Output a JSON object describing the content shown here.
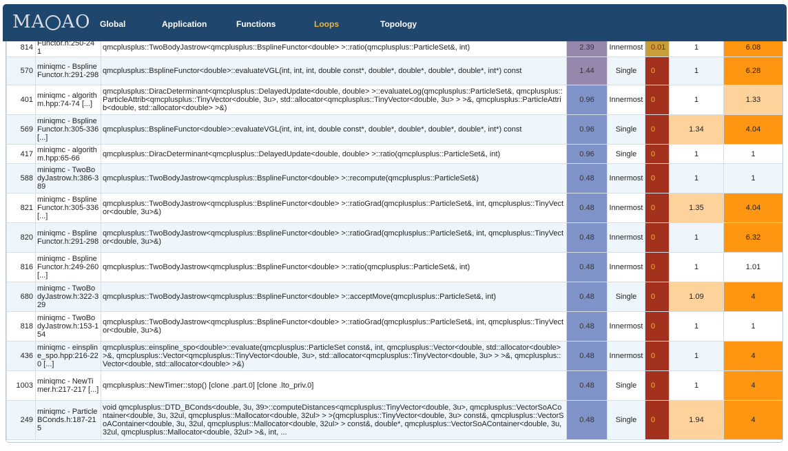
{
  "brand": {
    "logo_text_left": "MA",
    "logo_text_right": "AO"
  },
  "nav": [
    {
      "label": "Global",
      "active": false
    },
    {
      "label": "Application",
      "active": false
    },
    {
      "label": "Functions",
      "active": false
    },
    {
      "label": "Loops",
      "active": true
    },
    {
      "label": "Topology",
      "active": false
    }
  ],
  "colors": {
    "navbar": "#1f466d",
    "active_nav": "#f0b43a",
    "coverage": "#7f93c8",
    "coverage_hot": "#9687ad",
    "vector_ratio_zero": "#a4301e",
    "speedup_high": "#ff9612",
    "speedup_mid": "#fdd39b"
  },
  "rows": [
    {
      "id": "814",
      "source": "Functor.h:250-24 1",
      "function": "qmcplusplus::TwoBodyJastrow<qmcplusplus::BsplineFunctor<double> >::ratio(qmcplusplus::ParticleSet&, int)",
      "coverage": "2.39",
      "level": "Innermost",
      "vr": "0.01",
      "s1": "1",
      "s2": "6.08",
      "h": 16
    },
    {
      "id": "570",
      "source": "miniqmc - BsplineFunctor.h:291-298",
      "function": "qmcplusplus::BsplineFunctor<double>::evaluateVGL(int, int, int, double const*, double*, double*, double*, double*, int*) const",
      "coverage": "1.44",
      "level": "Single",
      "vr": "0",
      "s1": "1",
      "s2": "6.28",
      "h": 41
    },
    {
      "id": "401",
      "source": "miniqmc - algorithm.hpp:74-74 [...]",
      "function": "qmcplusplus::DiracDeterminant<qmcplusplus::DelayedUpdate<double, double> >::evaluateLog(qmcplusplus::ParticleSet&, qmcplusplus::ParticleAttrib<qmcplusplus::TinyVector<double, 3u>, std::allocator<qmcplusplus::TinyVector<double, 3u> > >&, qmcplusplus::ParticleAttrib<double, std::allocator<double> >&)",
      "coverage": "0.96",
      "level": "Innermost",
      "vr": "0",
      "s1": "1",
      "s2": "1.33",
      "h": 43
    },
    {
      "id": "569",
      "source": "miniqmc - BsplineFunctor.h:305-336 [...]",
      "function": "qmcplusplus::BsplineFunctor<double>::evaluateVGL(int, int, int, double const*, double*, double*, double*, double*, int*) const",
      "coverage": "0.96",
      "level": "Single",
      "vr": "0",
      "s1": "1.34",
      "s2": "4.04",
      "h": 43
    },
    {
      "id": "417",
      "source": "miniqmc - algorithm.hpp:65-66",
      "function": "qmcplusplus::DiracDeterminant<qmcplusplus::DelayedUpdate<double, double> >::ratio(qmcplusplus::ParticleSet&, int)",
      "coverage": "0.96",
      "level": "Single",
      "vr": "0",
      "s1": "1",
      "s2": "1",
      "h": 28
    },
    {
      "id": "588",
      "source": "miniqmc - TwoBodyJastrow.h:386-389",
      "function": "qmcplusplus::TwoBodyJastrow<qmcplusplus::BsplineFunctor<double> >::recompute(qmcplusplus::ParticleSet&)",
      "coverage": "0.48",
      "level": "Innermost",
      "vr": "0",
      "s1": "1",
      "s2": "1",
      "h": 43
    },
    {
      "id": "821",
      "source": "miniqmc - BsplineFunctor.h:305-336 [...]",
      "function": "qmcplusplus::TwoBodyJastrow<qmcplusplus::BsplineFunctor<double> >::ratioGrad(qmcplusplus::ParticleSet&, int, qmcplusplus::TinyVector<double, 3u>&)",
      "coverage": "0.48",
      "level": "Innermost",
      "vr": "0",
      "s1": "1.35",
      "s2": "4.04",
      "h": 43
    },
    {
      "id": "820",
      "source": "miniqmc - BsplineFunctor.h:291-298",
      "function": "qmcplusplus::TwoBodyJastrow<qmcplusplus::BsplineFunctor<double> >::ratioGrad(qmcplusplus::ParticleSet&, int, qmcplusplus::TinyVector<double, 3u>&)",
      "coverage": "0.48",
      "level": "Innermost",
      "vr": "0",
      "s1": "1",
      "s2": "6.32",
      "h": 43
    },
    {
      "id": "816",
      "source": "miniqmc - BsplineFunctor.h:249-260 [...]",
      "function": "qmcplusplus::TwoBodyJastrow<qmcplusplus::BsplineFunctor<double> >::ratio(qmcplusplus::ParticleSet&, int)",
      "coverage": "0.48",
      "level": "Innermost",
      "vr": "0",
      "s1": "1",
      "s2": "1.01",
      "h": 43
    },
    {
      "id": "680",
      "source": "miniqmc - TwoBodyJastrow.h:322-329",
      "function": "qmcplusplus::TwoBodyJastrow<qmcplusplus::BsplineFunctor<double> >::acceptMove(qmcplusplus::ParticleSet&, int)",
      "coverage": "0.48",
      "level": "Single",
      "vr": "0",
      "s1": "1.09",
      "s2": "4",
      "h": 43
    },
    {
      "id": "818",
      "source": "miniqmc - TwoBodyJastrow.h:153-154",
      "function": "qmcplusplus::TwoBodyJastrow<qmcplusplus::BsplineFunctor<double> >::ratioGrad(qmcplusplus::ParticleSet&, int, qmcplusplus::TinyVector<double, 3u>&)",
      "coverage": "0.48",
      "level": "Innermost",
      "vr": "0",
      "s1": "1",
      "s2": "1",
      "h": 43
    },
    {
      "id": "436",
      "source": "miniqmc - einspline_spo.hpp:216-220 [...]",
      "function": "qmcplusplus::einspline_spo<double>::evaluate(qmcplusplus::ParticleSet const&, int, qmcplusplus::Vector<double, std::allocator<double> >&, qmcplusplus::Vector<qmcplusplus::TinyVector<double, 3u>, std::allocator<qmcplusplus::TinyVector<double, 3u> > >&, qmcplusplus::Vector<double, std::allocator<double> >&)",
      "coverage": "0.48",
      "level": "Innermost",
      "vr": "0",
      "s1": "1",
      "s2": "4",
      "h": 43
    },
    {
      "id": "1003",
      "source": "miniqmc - NewTimer.h:217-217 [...]",
      "function": "qmcplusplus::NewTimer::stop() [clone .part.0] [clone .lto_priv.0]",
      "coverage": "0.48",
      "level": "Single",
      "vr": "0",
      "s1": "1",
      "s2": "4",
      "h": 43
    },
    {
      "id": "249",
      "source": "miniqmc - ParticleBConds.h:187-215",
      "function": "void qmcplusplus::DTD_BConds<double, 3u, 39>::computeDistances<qmcplusplus::TinyVector<double, 3u>, qmcplusplus::VectorSoAContainer<double, 3u, 32ul, qmcplusplus::Mallocator<double, 32ul> > >(qmcplusplus::TinyVector<double, 3u> const&, qmcplusplus::VectorSoAContainer<double, 3u, 32ul, qmcplusplus::Mallocator<double, 32ul> > const&, double*, qmcplusplus::VectorSoAContainer<double, 3u, 32ul, qmcplusplus::Mallocator<double, 32ul> >&, int, ...",
      "coverage": "0.48",
      "level": "Single",
      "vr": "0",
      "s1": "1.94",
      "s2": "4",
      "h": 57
    }
  ]
}
